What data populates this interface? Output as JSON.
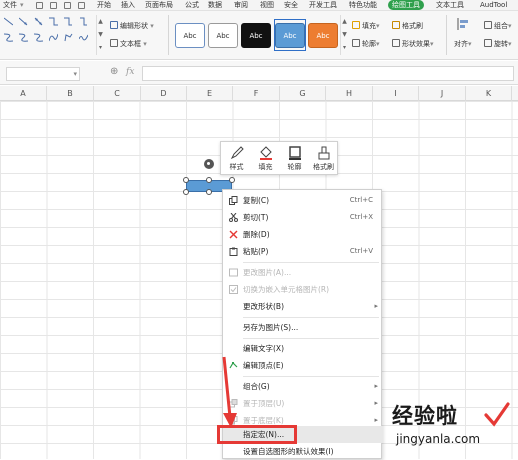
{
  "menubar": {
    "items": [
      "文件",
      "开始",
      "插入",
      "页面布局",
      "公式",
      "数据",
      "审阅",
      "视图",
      "安全",
      "开发工具",
      "特色功能",
      "绘图工具",
      "文本工具",
      "AudTool"
    ],
    "active_item": "绘图工具",
    "active_color": "#2fa04d"
  },
  "ribbon": {
    "edit_shape": "编辑形状",
    "text_box": "文本框",
    "style_samples": [
      {
        "label": "Abc",
        "fill": "#ffffff",
        "text": "#333333",
        "border": "#6b8fc2"
      },
      {
        "label": "Abc",
        "fill": "#ffffff",
        "text": "#333333",
        "border": "#9a9a9a"
      },
      {
        "label": "Abc",
        "fill": "#111111",
        "text": "#ffffff",
        "border": "#111111"
      },
      {
        "label": "Abc",
        "fill": "#5b9bd5",
        "text": "#ffffff",
        "border": "#3a6fa8"
      },
      {
        "label": "Abc",
        "fill": "#ed7d31",
        "text": "#ffffff",
        "border": "#c5641f"
      }
    ],
    "fill": "填充",
    "format_painter": "格式刷",
    "outline": "轮廓",
    "shape_effects": "形状效果",
    "align": "对齐",
    "group": "组合",
    "rotate": "旋转"
  },
  "formula_bar": {
    "fx": "fx"
  },
  "columns": [
    "A",
    "B",
    "C",
    "D",
    "E",
    "F",
    "G",
    "H",
    "I",
    "J",
    "K"
  ],
  "mini_toolbar": [
    {
      "label": "样式",
      "icon": "pen-style-icon"
    },
    {
      "label": "填充",
      "icon": "fill-bucket-icon"
    },
    {
      "label": "轮廓",
      "icon": "outline-square-icon"
    },
    {
      "label": "格式刷",
      "icon": "format-brush-icon"
    }
  ],
  "context_menu": [
    {
      "label": "复制(C)",
      "shortcut": "Ctrl+C",
      "icon": "copy-icon",
      "disabled": false
    },
    {
      "label": "剪切(T)",
      "shortcut": "Ctrl+X",
      "icon": "scissors-icon",
      "disabled": false
    },
    {
      "label": "删除(D)",
      "shortcut": "",
      "icon": "delete-x-icon",
      "disabled": false
    },
    {
      "label": "粘贴(P)",
      "shortcut": "Ctrl+V",
      "icon": "paste-icon",
      "disabled": false
    },
    {
      "label": "更改图片(A)...",
      "shortcut": "",
      "icon": "change-picture-icon",
      "disabled": true
    },
    {
      "label": "切换为嵌入单元格图片(R)",
      "shortcut": "",
      "icon": "embed-picture-icon",
      "disabled": true
    },
    {
      "label": "更改形状(B)",
      "shortcut": "",
      "icon": "",
      "disabled": false,
      "submenu": true
    },
    {
      "label": "另存为图片(S)...",
      "shortcut": "",
      "icon": "",
      "disabled": false
    },
    {
      "label": "编辑文字(X)",
      "shortcut": "",
      "icon": "",
      "disabled": false
    },
    {
      "label": "编辑顶点(E)",
      "shortcut": "",
      "icon": "edit-points-icon",
      "disabled": false
    },
    {
      "label": "组合(G)",
      "shortcut": "",
      "icon": "",
      "disabled": false,
      "submenu": true
    },
    {
      "label": "置于顶层(U)",
      "shortcut": "",
      "icon": "bring-front-icon",
      "disabled": true,
      "submenu": true
    },
    {
      "label": "置于底层(K)",
      "shortcut": "",
      "icon": "send-back-icon",
      "disabled": true,
      "submenu": true
    },
    {
      "label": "指定宏(N)...",
      "shortcut": "",
      "icon": "",
      "disabled": false,
      "highlighted": true
    },
    {
      "label": "设置自选图形的默认效果(I)",
      "shortcut": "",
      "icon": "",
      "disabled": false
    }
  ],
  "watermark": {
    "title": "经验啦",
    "url": "jingyanla.com"
  },
  "annotation_color": "#e53935"
}
